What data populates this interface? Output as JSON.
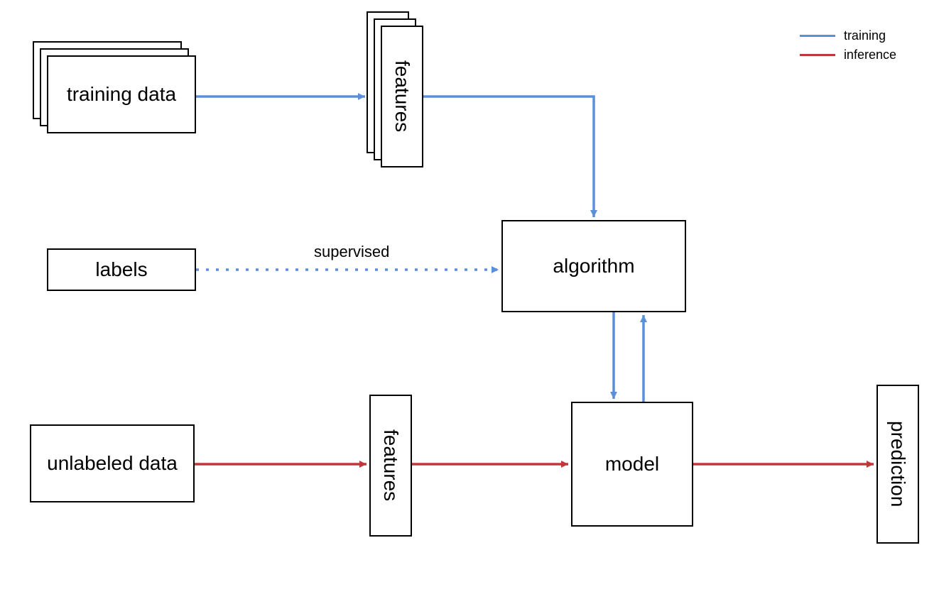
{
  "nodes": {
    "training_data": "training data",
    "features_top": "features",
    "labels": "labels",
    "algorithm": "algorithm",
    "unlabeled_data": "unlabeled data",
    "features_bottom": "features",
    "model": "model",
    "prediction": "prediction"
  },
  "edges": {
    "supervised": "supervised"
  },
  "legend": {
    "training": "training",
    "inference": "inference"
  },
  "colors": {
    "training": "#5b8fd8",
    "inference": "#c13838"
  }
}
